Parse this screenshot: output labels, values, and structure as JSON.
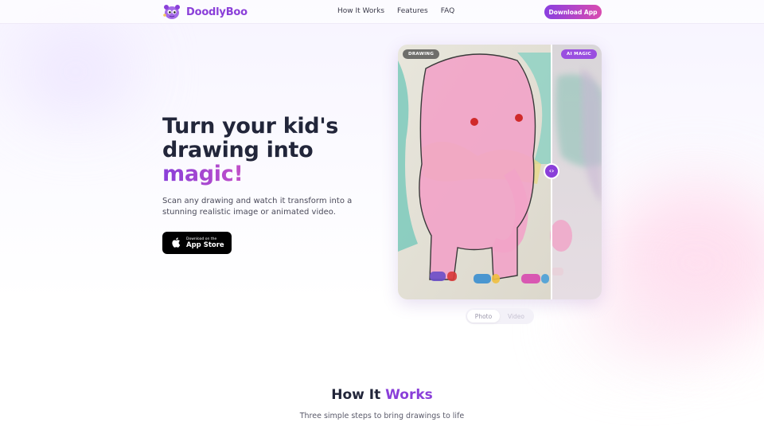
{
  "brand": {
    "name": "DoodlyBoo",
    "color": "#8a3fd9"
  },
  "nav": {
    "links": [
      "How It Works",
      "Features",
      "FAQ"
    ],
    "cta_label": "Download App"
  },
  "hero": {
    "title_line1": "Turn your kid's",
    "title_line2": "drawing into",
    "title_accent": "magic!",
    "subtitle": "Scan any drawing and watch it transform into a stunning realistic image or animated video.",
    "app_store": {
      "small_label": "Download on the",
      "big_label": "App Store",
      "icon": "apple-icon"
    }
  },
  "compare": {
    "left_badge": "DRAWING",
    "right_badge": "AI MAGIC",
    "handle_icon": "chevron-left-right-icon",
    "handle_glyph": "‹›",
    "accent": "#9a4fe0"
  },
  "toggle": {
    "options": [
      "Photo",
      "Video"
    ],
    "selected": "Photo"
  },
  "how_it_works": {
    "title_plain": "How It",
    "title_accent": "Works",
    "subtitle": "Three simple steps to bring drawings to life"
  }
}
